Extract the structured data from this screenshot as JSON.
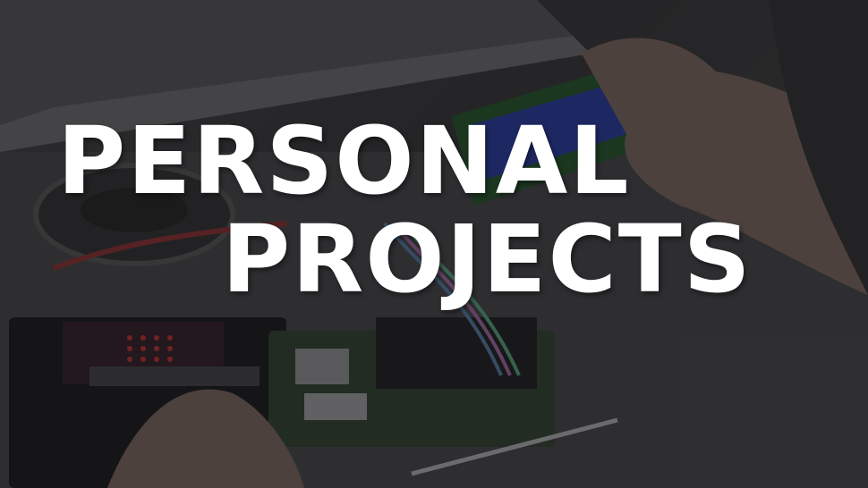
{
  "title": {
    "line1": "PERSONAL",
    "line2": "PROJECTS"
  },
  "image": {
    "subject": "hands-on-electronics-photo"
  },
  "colors": {
    "title_text": "#ffffff",
    "overlay": "#1e1e20"
  }
}
